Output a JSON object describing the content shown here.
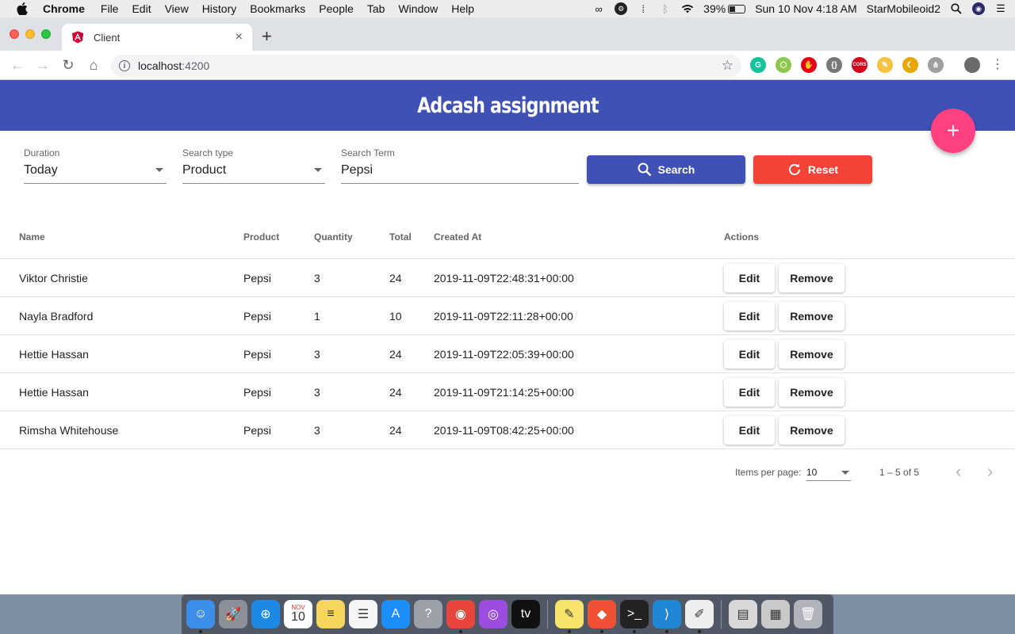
{
  "menubar": {
    "app_name": "Chrome",
    "items": [
      "File",
      "Edit",
      "View",
      "History",
      "Bookmarks",
      "People",
      "Tab",
      "Window",
      "Help"
    ],
    "battery": "39%",
    "clock": "Sun 10 Nov  4:18 AM",
    "user": "StarMobileoid2"
  },
  "browser": {
    "tab_title": "Client",
    "new_tab": "+",
    "close": "×",
    "url_host": "localhost",
    "url_port": ":4200",
    "extensions": [
      {
        "name": "grammarly-extension-icon",
        "label": "G",
        "color": "#15c39a"
      },
      {
        "name": "node-extension-icon",
        "label": "⬡",
        "color": "#8cc84b"
      },
      {
        "name": "adblock-extension-icon",
        "label": "✋",
        "color": "#e2001a"
      },
      {
        "name": "json-extension-icon",
        "label": "{}",
        "color": "#777777"
      },
      {
        "name": "cors-extension-icon",
        "label": "CORS",
        "color": "#d0021b"
      },
      {
        "name": "sticky-note-extension-icon",
        "label": "✎",
        "color": "#f5c244"
      },
      {
        "name": "moon-extension-icon",
        "label": "☾",
        "color": "#e6a800"
      },
      {
        "name": "tree-extension-icon",
        "label": "⋔",
        "color": "#9e9e9e"
      }
    ]
  },
  "app": {
    "title": "Adcash assignment",
    "fab_label": "+",
    "colors": {
      "primary": "#3f51b5",
      "accent": "#ff4081",
      "warn": "#f44336"
    }
  },
  "filters": {
    "duration": {
      "label": "Duration",
      "value": "Today"
    },
    "search_type": {
      "label": "Search type",
      "value": "Product"
    },
    "search_term": {
      "label": "Search Term",
      "value": "Pepsi"
    },
    "search_button": "Search",
    "reset_button": "Reset"
  },
  "table": {
    "headers": [
      "Name",
      "Product",
      "Quantity",
      "Total",
      "Created At",
      "Actions"
    ],
    "edit_label": "Edit",
    "remove_label": "Remove",
    "rows": [
      {
        "name": "Viktor Christie",
        "product": "Pepsi",
        "quantity": "3",
        "total": "24",
        "created_at": "2019-11-09T22:48:31+00:00"
      },
      {
        "name": "Nayla Bradford",
        "product": "Pepsi",
        "quantity": "1",
        "total": "10",
        "created_at": "2019-11-09T22:11:28+00:00"
      },
      {
        "name": "Hettie Hassan",
        "product": "Pepsi",
        "quantity": "3",
        "total": "24",
        "created_at": "2019-11-09T22:05:39+00:00"
      },
      {
        "name": "Hettie Hassan",
        "product": "Pepsi",
        "quantity": "3",
        "total": "24",
        "created_at": "2019-11-09T21:14:25+00:00"
      },
      {
        "name": "Rimsha Whitehouse",
        "product": "Pepsi",
        "quantity": "3",
        "total": "24",
        "created_at": "2019-11-09T08:42:25+00:00"
      }
    ]
  },
  "paginator": {
    "items_per_page_label": "Items per page:",
    "items_per_page": "10",
    "range": "1 – 5 of 5"
  },
  "dock": {
    "calendar_month": "NOV",
    "calendar_day": "10",
    "apps": [
      {
        "name": "finder-dock-icon",
        "label": "☺",
        "color": "#3d8ee8"
      },
      {
        "name": "launchpad-dock-icon",
        "label": "🚀",
        "color": "#8a8f98"
      },
      {
        "name": "safari-dock-icon",
        "label": "⊕",
        "color": "#1e88e5"
      },
      {
        "name": "calendar-dock-icon",
        "label": "10",
        "color": "#ffffff"
      },
      {
        "name": "notes-dock-icon",
        "label": "≡",
        "color": "#f6d55c"
      },
      {
        "name": "reminders-dock-icon",
        "label": "☰",
        "color": "#f5f5f5"
      },
      {
        "name": "app-store-dock-icon",
        "label": "A",
        "color": "#1c8ef9"
      },
      {
        "name": "help-dock-icon",
        "label": "?",
        "color": "#9aa0a6"
      },
      {
        "name": "chrome-dock-icon",
        "label": "◉",
        "color": "#e8453c"
      },
      {
        "name": "podcasts-dock-icon",
        "label": "◎",
        "color": "#9b4de0"
      },
      {
        "name": "apple-tv-dock-icon",
        "label": "tv",
        "color": "#111111"
      },
      {
        "name": "stickies-dock-icon",
        "label": "✎",
        "color": "#f7e36b"
      },
      {
        "name": "git-dock-icon",
        "label": "◆",
        "color": "#f05033"
      },
      {
        "name": "terminal-dock-icon",
        "label": ">_",
        "color": "#222222"
      },
      {
        "name": "vscode-dock-icon",
        "label": "⟩",
        "color": "#1f87d6"
      },
      {
        "name": "textedit-dock-icon",
        "label": "✐",
        "color": "#eeeeee"
      },
      {
        "name": "documents-dock-icon",
        "label": "▤",
        "color": "#d8d8d8"
      },
      {
        "name": "downloads-dock-icon",
        "label": "▦",
        "color": "#c9c9c9"
      },
      {
        "name": "trash-dock-icon",
        "label": "🗑",
        "color": "#b0b4ba"
      }
    ]
  }
}
